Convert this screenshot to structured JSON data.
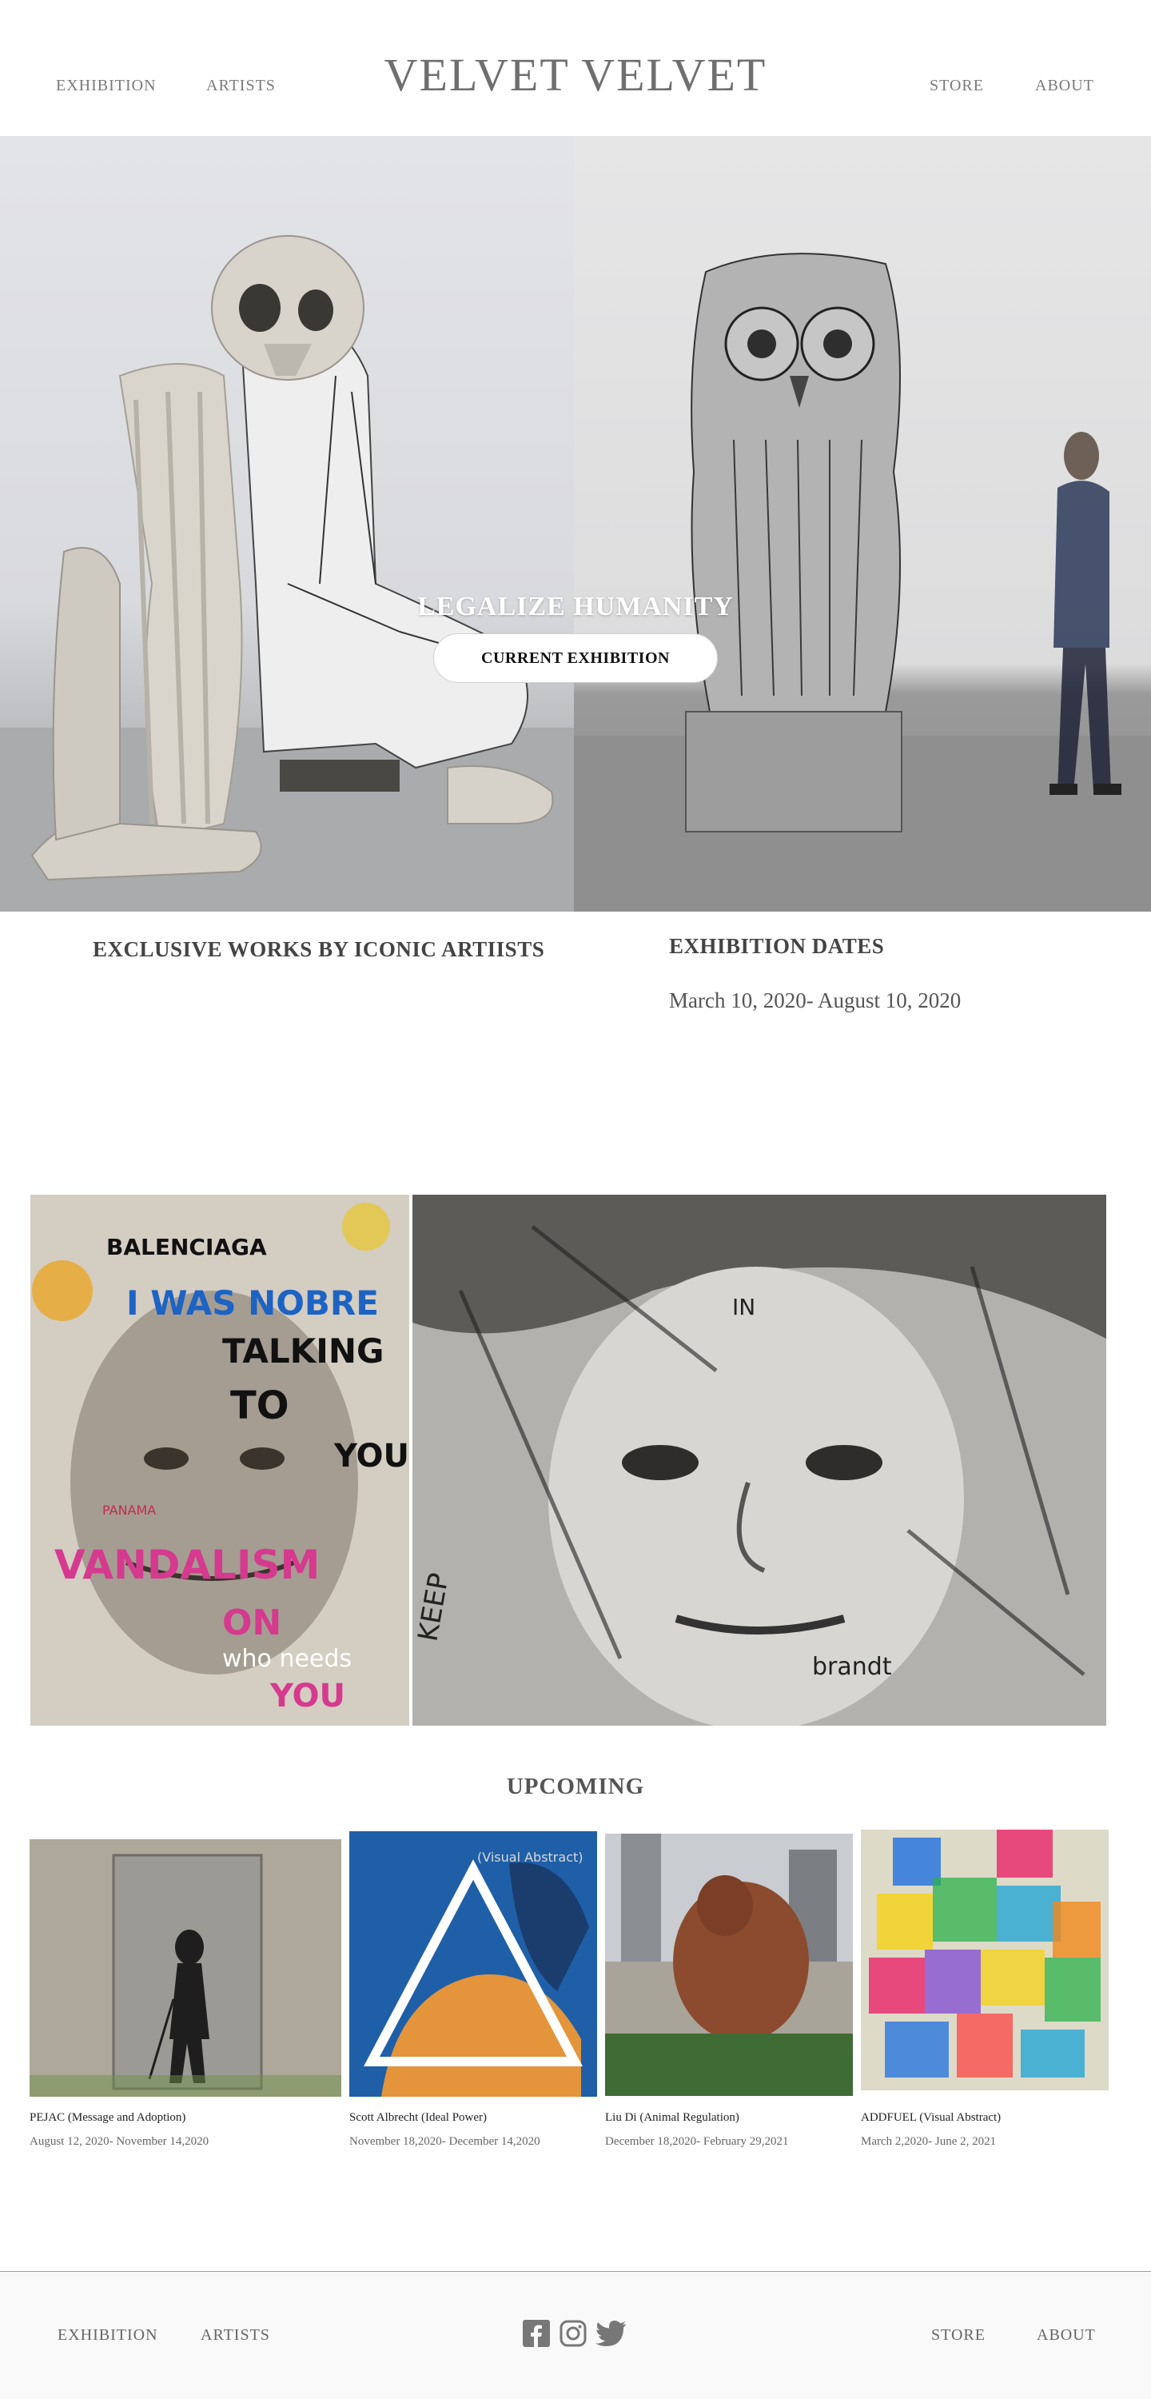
{
  "header": {
    "brand": "VELVET VELVET",
    "nav_left": [
      "EXHIBITION",
      "ARTISTS"
    ],
    "nav_right": [
      "STORE",
      "ABOUT"
    ]
  },
  "hero": {
    "title": "LEGALIZE HUMANITY",
    "button_label": "CURRENT EXHIBITION"
  },
  "info": {
    "tagline": "EXCLUSIVE WORKS BY ICONIC ARTIISTS",
    "dates_title": "EXHIBITION DATES",
    "dates_value": "March 10, 2020- August 10, 2020"
  },
  "gallery": {
    "left_painting_text": [
      "BALENCIAGA",
      "I WAS NOBRE",
      "TALKING",
      "TO",
      "YOU",
      "PANAMA",
      "VANDALISM",
      "ON",
      "who needs",
      "YOU"
    ],
    "right_painting_text": [
      "IN",
      "KEEP",
      "brandt"
    ]
  },
  "upcoming": {
    "title": "UPCOMING",
    "items": [
      {
        "caption": "PEJAC (Message and Adoption)",
        "dates": "August 12, 2020- November 14,2020"
      },
      {
        "caption": "Scott Albrecht (Ideal Power)",
        "dates": "November 18,2020- December 14,2020",
        "overlay": "(Visual Abstract)"
      },
      {
        "caption": "Liu Di (Animal Regulation)",
        "dates": "December 18,2020- February 29,2021"
      },
      {
        "caption": "ADDFUEL (Visual Abstract)",
        "dates": "March 2,2020- June 2, 2021"
      }
    ]
  },
  "footer": {
    "nav_left": [
      "EXHIBITION",
      "ARTISTS"
    ],
    "nav_right": [
      "STORE",
      "ABOUT"
    ],
    "social_icons": [
      "facebook-icon",
      "instagram-icon",
      "twitter-icon"
    ]
  },
  "colors": {
    "nav_text": "#7a7a7a",
    "heading_text": "#444444",
    "footer_bg": "#f9f9f9",
    "button_bg": "#ffffff"
  }
}
